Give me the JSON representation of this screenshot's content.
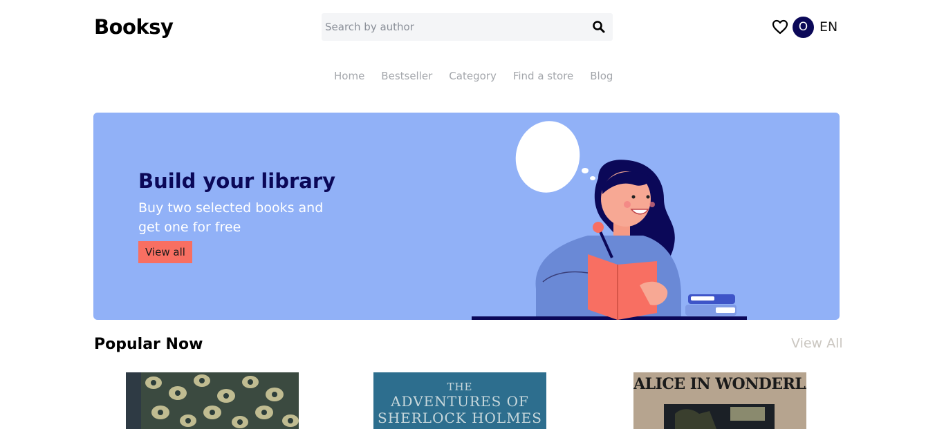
{
  "header": {
    "logo": "Booksy",
    "search": {
      "placeholder": "Search by author",
      "value": ""
    },
    "avatar_initial": "O",
    "language": "EN",
    "icons": [
      "search-icon",
      "heart-icon"
    ]
  },
  "nav": {
    "items": [
      {
        "label": "Home"
      },
      {
        "label": "Bestseller"
      },
      {
        "label": "Category"
      },
      {
        "label": "Find a store"
      },
      {
        "label": "Blog"
      }
    ]
  },
  "hero": {
    "title": "Build your library",
    "subtitle": "Buy two selected books and get one for free",
    "button_label": "View all"
  },
  "popular": {
    "title": "Popular Now",
    "view_all": "View All",
    "books": [
      {
        "cover_text": []
      },
      {
        "cover_text": [
          "THE",
          "ADVENTURES OF",
          "SHERLOCK HOLMES"
        ]
      },
      {
        "cover_text": [
          "ALICE IN WONDERLAND"
        ]
      }
    ]
  },
  "colors": {
    "hero_bg": "#91b1f7",
    "hero_title": "#0b0858",
    "accent": "#f86f62",
    "avatar_bg": "#0b0858",
    "nav_text": "#a3a6ab"
  }
}
